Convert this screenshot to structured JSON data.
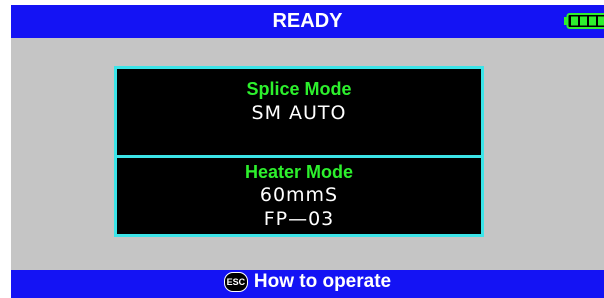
{
  "header": {
    "title": "READY",
    "battery_icon": "battery-full-icon",
    "battery_color": "#2df02d",
    "battery_level": 1.0
  },
  "panel": {
    "splice": {
      "title": "Splice Mode",
      "value": "SM AUTO"
    },
    "heater": {
      "title": "Heater Mode",
      "value_1": "60mmS",
      "value_2": "FP—03"
    }
  },
  "footer": {
    "key_label": "ESC",
    "key_icon": "esc-key-icon",
    "label": "How to operate"
  },
  "colors": {
    "bar_blue": "#1413f4",
    "panel_border": "#3ce4e8",
    "title_green": "#2df02d",
    "background_gray": "#c5c5c5"
  }
}
